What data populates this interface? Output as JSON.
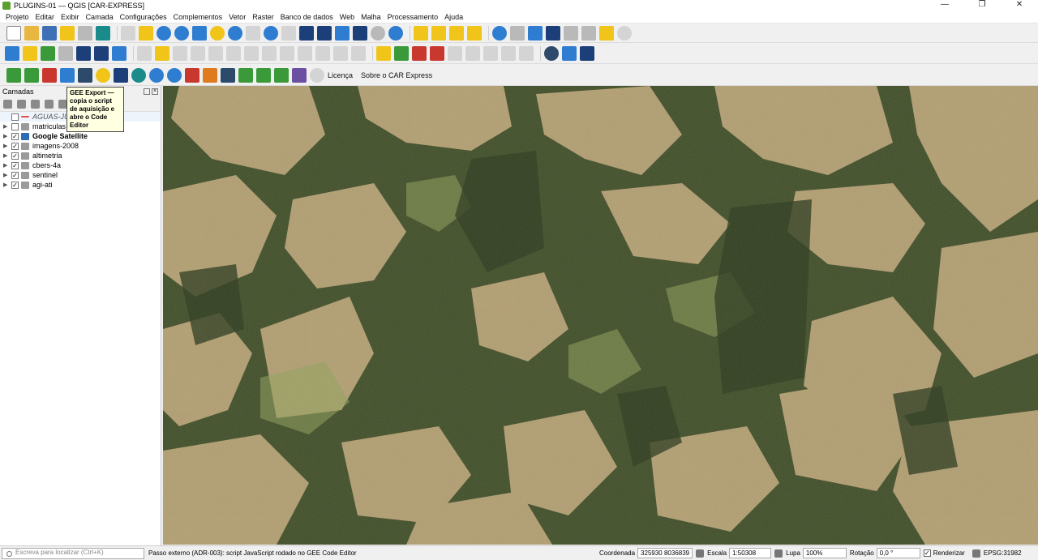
{
  "window": {
    "title": "PLUGINS-01 — QGIS [CAR-EXPRESS]",
    "minimize": "—",
    "maximize": "❐",
    "close": "✕"
  },
  "menu": [
    "Projeto",
    "Editar",
    "Exibir",
    "Camada",
    "Configurações",
    "Complementos",
    "Vetor",
    "Raster",
    "Banco de dados",
    "Web",
    "Malha",
    "Processamento",
    "Ajuda"
  ],
  "plugin_toolbar": {
    "license_label": "Licença",
    "about_label": "Sobre o CAR Express"
  },
  "layers_panel": {
    "title": "Camadas",
    "layers": [
      {
        "name": "AGUAS-JU",
        "checked": false,
        "type": "vector",
        "style": "italic"
      },
      {
        "name": "matriculas",
        "checked": false,
        "type": "group",
        "style": "normal"
      },
      {
        "name": "Google Satellite",
        "checked": true,
        "type": "web",
        "style": "bold"
      },
      {
        "name": "imagens-2008",
        "checked": true,
        "type": "group",
        "style": "normal"
      },
      {
        "name": "altimetria",
        "checked": true,
        "type": "group",
        "style": "normal"
      },
      {
        "name": "cbers-4a",
        "checked": true,
        "type": "group",
        "style": "normal"
      },
      {
        "name": "sentinel",
        "checked": true,
        "type": "group",
        "style": "normal"
      },
      {
        "name": "agi-ati",
        "checked": true,
        "type": "group",
        "style": "normal"
      }
    ]
  },
  "tooltip": {
    "title": "GEE Export —",
    "body": "copia o script de aquisição e abre o Code Editor"
  },
  "statusbar": {
    "search_placeholder": "Escreva para localizar (Ctrl+K)",
    "message": "Passo externo (ADR-003): script JavaScript rodado no GEE Code Editor",
    "coord_label": "Coordenada",
    "coord_value": "325930  8036839",
    "scale_label": "Escala",
    "scale_value": "1:50308",
    "lupa_label": "Lupa",
    "lupa_value": "100%",
    "rotation_label": "Rotação",
    "rotation_value": "0,0 °",
    "render_label": "Renderizar",
    "crs": "EPSG:31982"
  }
}
